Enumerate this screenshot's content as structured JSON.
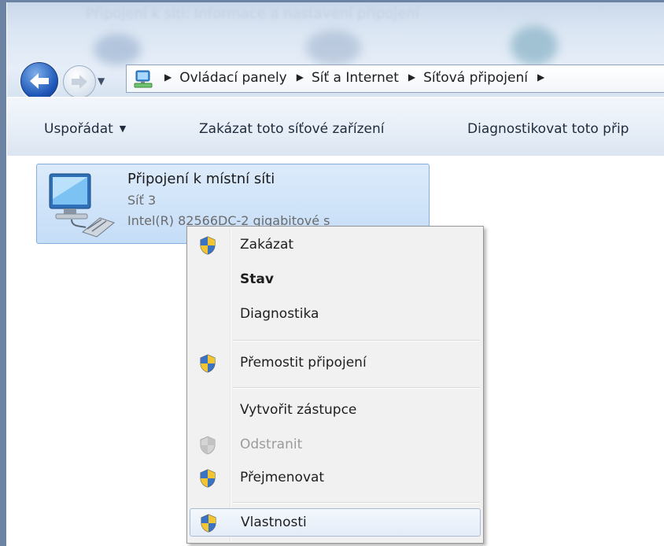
{
  "window_title_ghost": "Připojení k síti: Informace a nastavení připojení",
  "address_bar": {
    "crumbs": [
      "Ovládací panely",
      "Síť a Internet",
      "Síťová připojení"
    ]
  },
  "toolbar": {
    "organize": "Uspořádat",
    "disable_device": "Zakázat toto síťové zařízení",
    "diagnose_device": "Diagnostikovat toto přip"
  },
  "connection": {
    "name": "Připojení k místní síti",
    "network": "Síť 3",
    "adapter": "Intel(R) 82566DC-2 gigabitové s"
  },
  "context_menu": {
    "items": [
      {
        "label": "Zakázat",
        "shield": true
      },
      {
        "label": "Stav",
        "shield": false,
        "bold": true
      },
      {
        "label": "Diagnostika",
        "shield": false
      },
      {
        "label": "Přemostit připojení",
        "shield": true
      },
      {
        "label": "Vytvořit zástupce",
        "shield": false
      },
      {
        "label": "Odstranit",
        "shield": true,
        "disabled": true
      },
      {
        "label": "Přejmenovat",
        "shield": true
      },
      {
        "label": "Vlastnosti",
        "shield": true,
        "highlighted": true
      }
    ]
  },
  "colors": {
    "frame": "#6d83a3",
    "selection": "#c5ddf7",
    "menu_bg": "#f1f1f1"
  }
}
